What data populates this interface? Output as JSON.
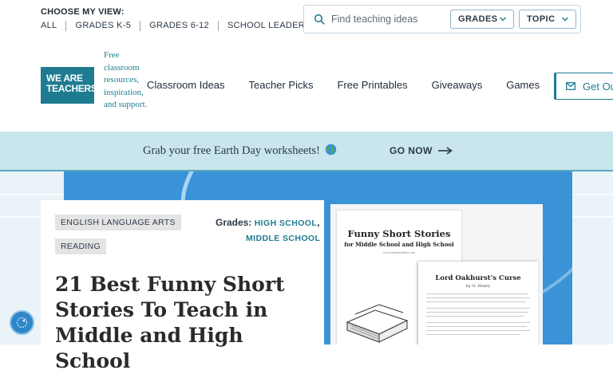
{
  "utility": {
    "view_title": "CHOOSE MY VIEW:",
    "views": [
      "ALL",
      "GRADES K-5",
      "GRADES 6-12",
      "SCHOOL LEADERS"
    ],
    "search_placeholder": "Find teaching ideas",
    "filter_grades": "GRADES",
    "filter_topic": "TOPIC"
  },
  "nav": {
    "logo_line1": "WE ARE",
    "logo_line2": "TEACHERS",
    "tagline": "Free classroom resources, inspiration, and support.",
    "links": [
      "Classroom Ideas",
      "Teacher Picks",
      "Free Printables",
      "Giveaways",
      "Games"
    ],
    "cta": "Get Ou"
  },
  "promo": {
    "text": "Grab your free Earth Day worksheets!",
    "cta": "GO NOW"
  },
  "article": {
    "tags": [
      "ENGLISH LANGUAGE ARTS",
      "READING"
    ],
    "grades_label": "Grades:",
    "grades": [
      "HIGH SCHOOL",
      "MIDDLE SCHOOL"
    ],
    "title": "21 Best Funny Short Stories To Teach in Middle and High School",
    "image": {
      "cover_title": "Funny Short Stories",
      "cover_subtitle": "for Middle School and High School",
      "cover_url": "www.weareteachers.com",
      "story_title": "Lord Oakhurst's Curse",
      "story_author": "by O. Henry"
    }
  },
  "icons": {
    "search": "search-icon",
    "chevron": "chevron-down-icon",
    "mail": "mail-icon",
    "globe": "globe-icon",
    "arrow": "arrow-right-icon",
    "fab": "accessibility-icon"
  },
  "colors": {
    "brand": "#1f7c90",
    "promo_bg": "#c8e6ec",
    "hero_blue": "#3a93d6"
  }
}
